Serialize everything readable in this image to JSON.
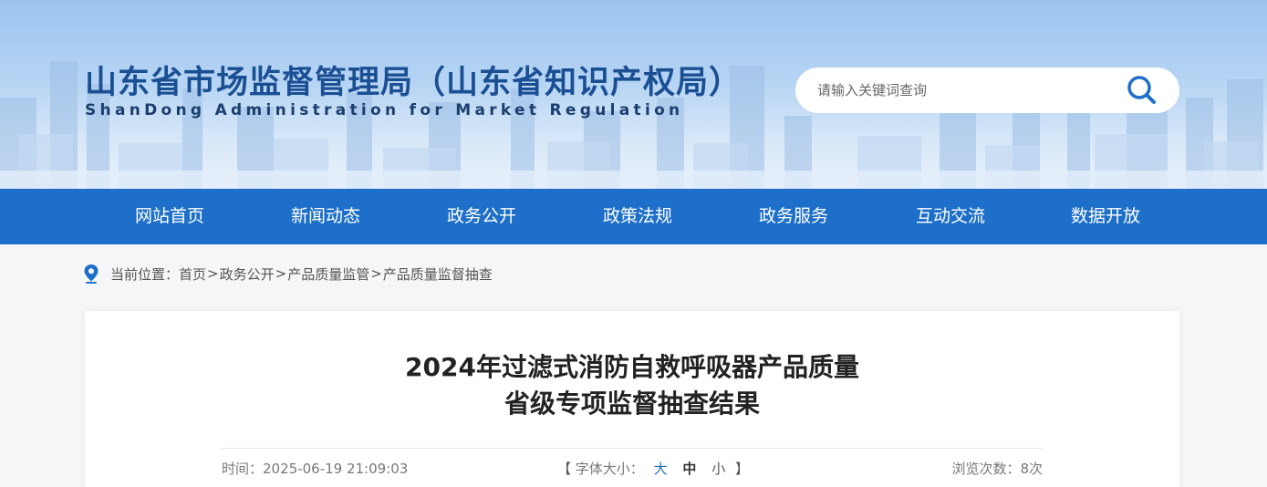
{
  "header": {
    "title": "山东省市场监督管理局（山东省知识产权局）",
    "subtitle": "ShanDong Administration for Market Regulation",
    "search": {
      "placeholder": "请输入关键词查询",
      "icon": "search-icon"
    }
  },
  "nav": {
    "items": [
      {
        "label": "网站首页"
      },
      {
        "label": "新闻动态"
      },
      {
        "label": "政务公开"
      },
      {
        "label": "政策法规"
      },
      {
        "label": "政务服务"
      },
      {
        "label": "互动交流"
      },
      {
        "label": "数据开放"
      }
    ]
  },
  "breadcrumb": {
    "prefix": "当前位置：",
    "items": [
      "首页",
      "政务公开",
      "产品质量监管",
      "产品质量监督抽查"
    ],
    "separator": ">"
  },
  "article": {
    "title_line1": "2024年过滤式消防自救呼吸器产品质量",
    "title_line2": "省级专项监督抽查结果",
    "time_label": "时间：",
    "time": "2025-06-19 21:09:03",
    "font_size_label": "字体大小：",
    "font_sizes": [
      "大",
      "中",
      "小"
    ],
    "bracket_open": "【",
    "bracket_close": "】",
    "views_label": "浏览次数：",
    "views": "8次"
  },
  "colors": {
    "nav_bg": "#1d6fc9",
    "title_blue": "#1b4f93",
    "active_font": "#1d6fc9"
  }
}
